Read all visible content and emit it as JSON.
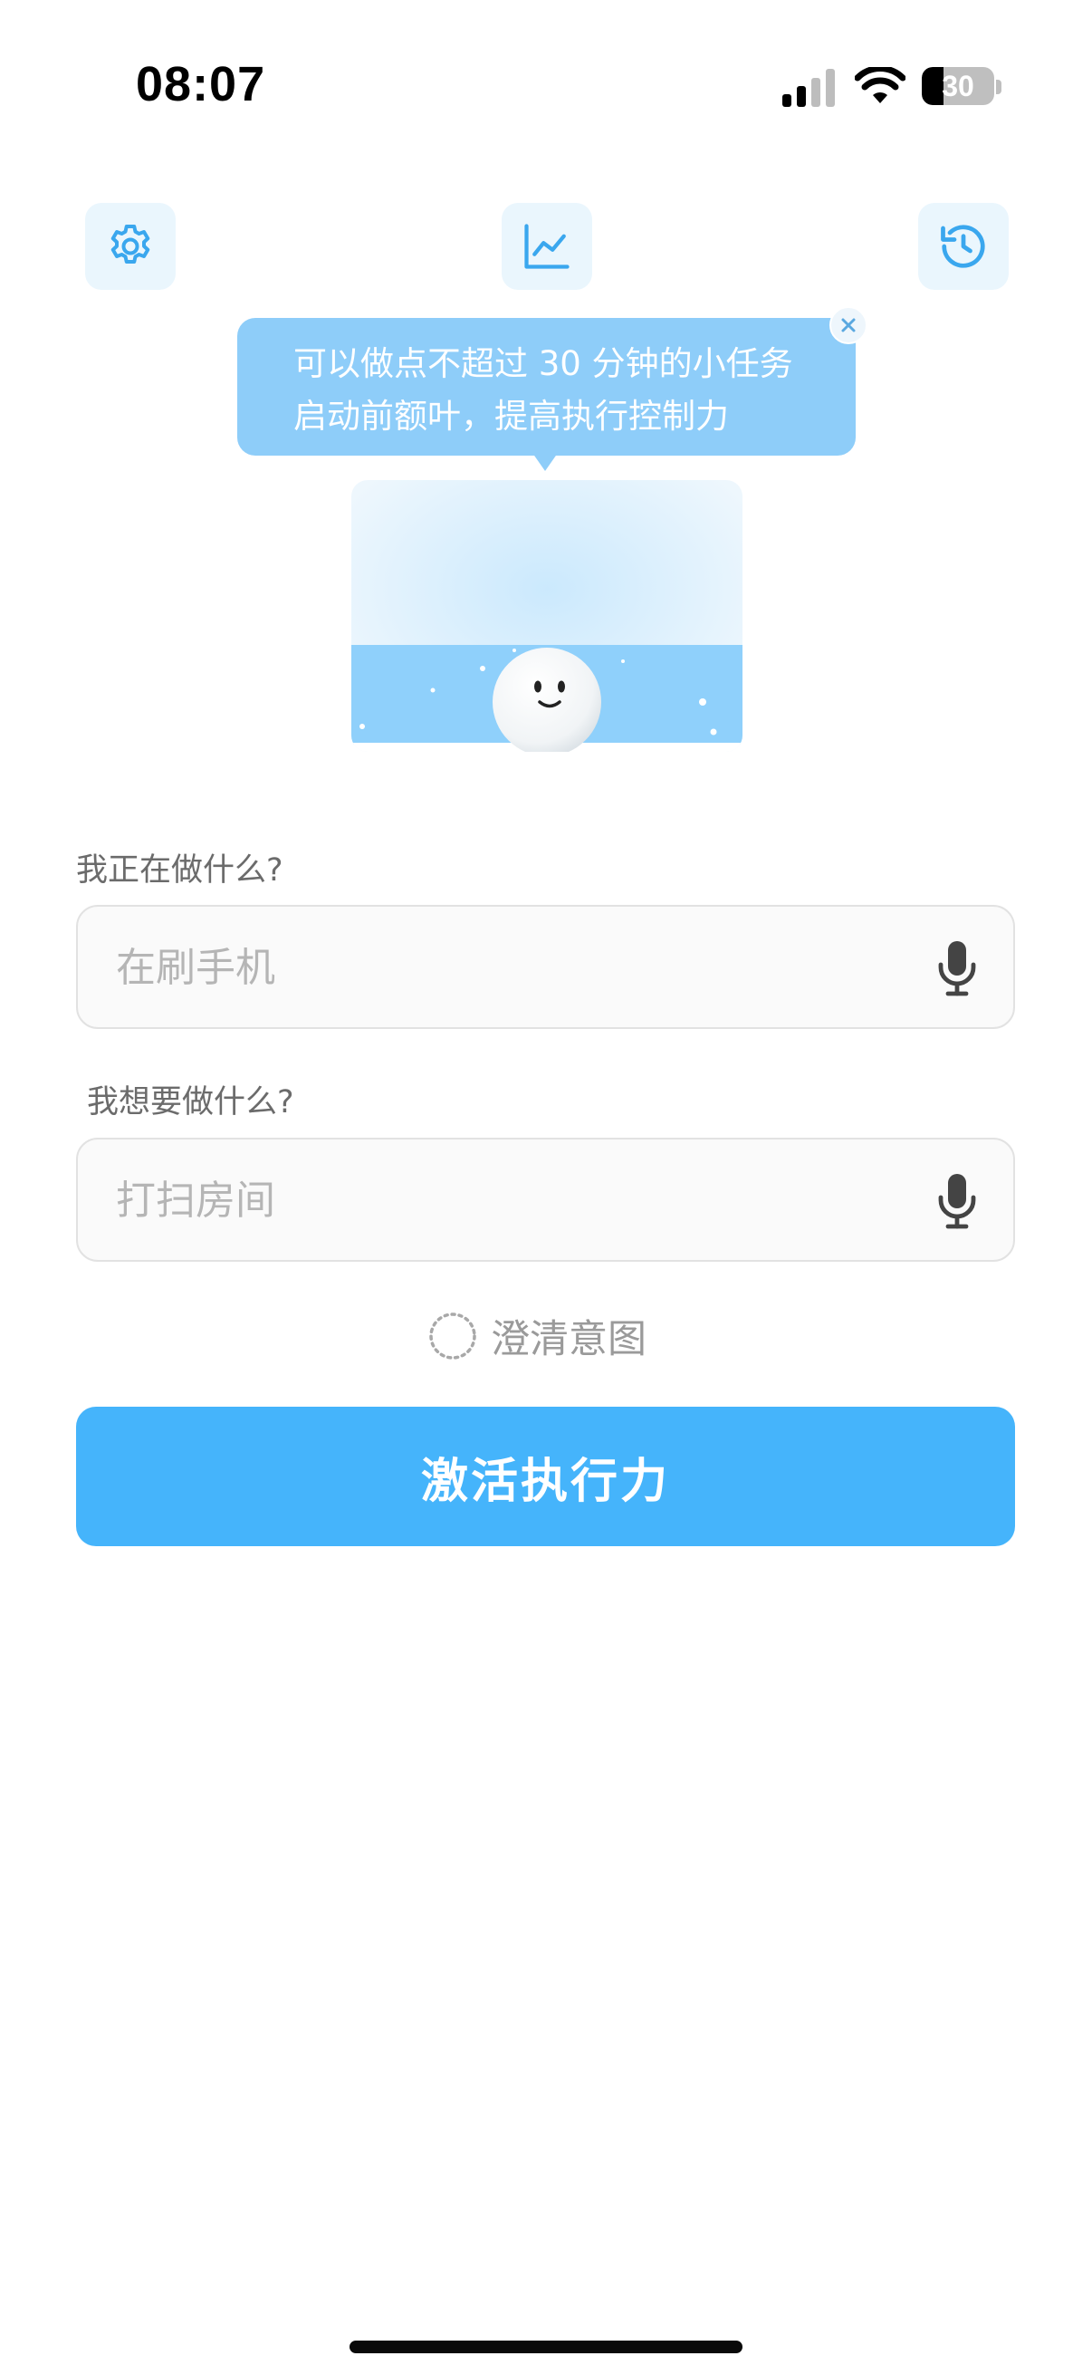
{
  "status_bar": {
    "time": "08:07",
    "battery_level": "30",
    "battery_fraction": 0.3,
    "signal_icon": "cellular-signal-icon",
    "wifi_icon": "wifi-icon"
  },
  "toolbar": {
    "settings_icon": "gear-icon",
    "stats_icon": "line-chart-icon",
    "history_icon": "history-clock-icon"
  },
  "tooltip": {
    "line1": "可以做点不超过 30 分钟的小任务",
    "line2": "启动前额叶，提高执行控制力"
  },
  "form": {
    "current_label": "我正在做什么?",
    "current_placeholder": "在刷手机",
    "goal_label": "我想要做什么?",
    "goal_placeholder": "打扫房间",
    "clarify_label": "澄清意图",
    "submit_label": "激活执行力"
  },
  "colors": {
    "accent": "#45b4fb",
    "tooltip_bg": "#8ecdf9",
    "icon_bg": "#eaf6fd",
    "icon_color": "#3aa7ee"
  }
}
